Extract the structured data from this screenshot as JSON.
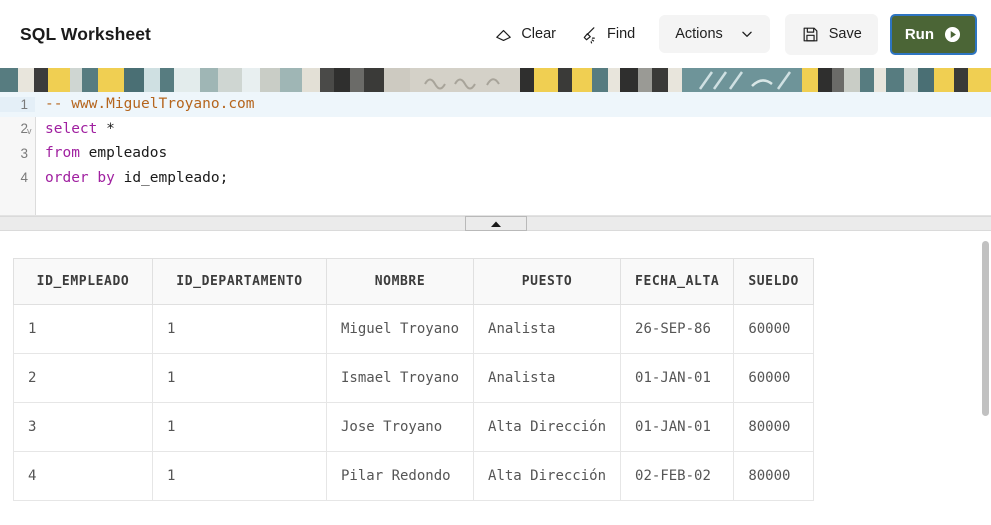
{
  "header": {
    "title": "SQL Worksheet",
    "buttons": {
      "clear": "Clear",
      "find": "Find",
      "actions": "Actions",
      "save": "Save",
      "run": "Run"
    }
  },
  "editor": {
    "lines": [
      {
        "number": "1",
        "fold": "",
        "tokens": [
          {
            "text": "-- www.MiguelTroyano.com",
            "type": "comment"
          }
        ]
      },
      {
        "number": "2",
        "fold": "v",
        "tokens": [
          {
            "text": "select",
            "type": "kw"
          },
          {
            "text": " *",
            "type": "plain"
          }
        ]
      },
      {
        "number": "3",
        "fold": "",
        "tokens": [
          {
            "text": "from",
            "type": "kw"
          },
          {
            "text": " empleados",
            "type": "plain"
          }
        ]
      },
      {
        "number": "4",
        "fold": "",
        "tokens": [
          {
            "text": "order",
            "type": "kw"
          },
          {
            "text": " ",
            "type": "plain"
          },
          {
            "text": "by",
            "type": "kw"
          },
          {
            "text": " id_empleado;",
            "type": "plain"
          }
        ]
      }
    ],
    "active_line": 1
  },
  "results": {
    "columns": [
      "ID_EMPLEADO",
      "ID_DEPARTAMENTO",
      "NOMBRE",
      "PUESTO",
      "FECHA_ALTA",
      "SUELDO"
    ],
    "rows": [
      [
        "1",
        "1",
        "Miguel Troyano",
        "Analista",
        "26-SEP-86",
        "60000"
      ],
      [
        "2",
        "1",
        "Ismael Troyano",
        "Analista",
        "01-JAN-01",
        "60000"
      ],
      [
        "3",
        "1",
        "Jose Troyano",
        "Alta Dirección",
        "01-JAN-01",
        "80000"
      ],
      [
        "4",
        "1",
        "Pilar Redondo",
        "Alta Dirección",
        "02-FEB-02",
        "80000"
      ]
    ]
  },
  "colors": {
    "run_button": "#4b6536",
    "focus_ring": "#2e75c2",
    "comment": "#b5651d",
    "keyword": "#a020a0",
    "active_line": "#eef6fb"
  }
}
